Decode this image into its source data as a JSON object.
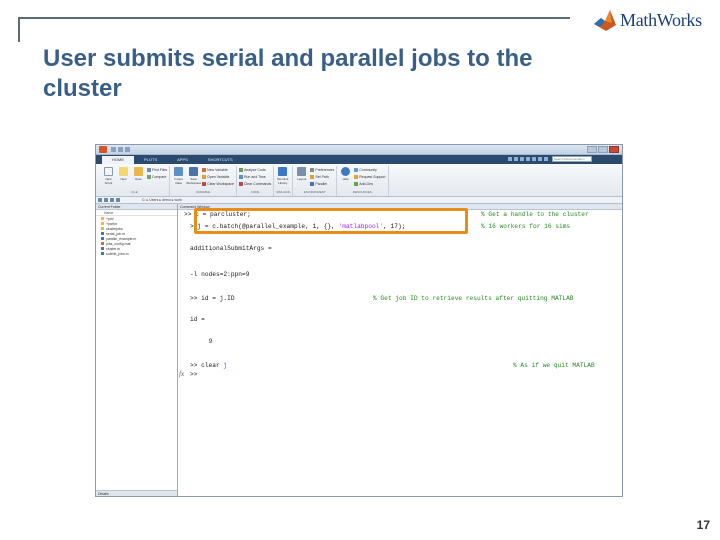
{
  "slide": {
    "title": "User submits serial and parallel jobs to the cluster",
    "logo_text": "MathWorks",
    "page_number": "17",
    "colors": {
      "title": "#3a5f86",
      "highlight": "#e58e1a",
      "frame": "#5a6b7a",
      "logo": "#1c3f7a"
    }
  },
  "matlab": {
    "tabs": [
      {
        "label": "HOME"
      },
      {
        "label": "PLOTS"
      },
      {
        "label": "APPS"
      },
      {
        "label": "SHORTCUTS"
      }
    ],
    "search_placeholder": "Search Documentation",
    "ribbon": {
      "groups": [
        {
          "label": "FILE",
          "big": [
            "New Script",
            "New",
            "Open"
          ],
          "small": [
            "Find Files",
            "Compare"
          ]
        },
        {
          "label": "VARIABLE",
          "big": [
            "Import Data",
            "Save Workspace"
          ],
          "small": [
            "New Variable",
            "Open Variable",
            "Clear Workspace"
          ]
        },
        {
          "label": "CODE",
          "small": [
            "Analyze Code",
            "Run and Time",
            "Clear Commands"
          ]
        },
        {
          "label": "SIMULINK",
          "big": [
            "Simulink Library"
          ]
        },
        {
          "label": "ENVIRONMENT",
          "big": [
            "Layout"
          ],
          "small": [
            "Preferences",
            "Set Path",
            "Parallel"
          ]
        },
        {
          "label": "RESOURCES",
          "big": [
            "Help"
          ],
          "small": [
            "Community",
            "Request Support",
            "Add-Ons"
          ]
        }
      ]
    },
    "address_path": "C: ▸ Users ▸ demo ▸ work",
    "current_folder": {
      "title": "Current Folder",
      "column_header": "Name",
      "items": [
        {
          "name": "+priv",
          "type": "folder"
        },
        {
          "name": "+parfor",
          "type": "folder"
        },
        {
          "name": "clusterjobs",
          "type": "folder"
        },
        {
          "name": "serial_job.m",
          "type": "m"
        },
        {
          "name": "parallel_example.m",
          "type": "m"
        },
        {
          "name": "jobs_config.mat",
          "type": "mat"
        },
        {
          "name": "cluster.m",
          "type": "m"
        },
        {
          "name": "submit_jobs.m",
          "type": "m"
        }
      ],
      "details_label": "Details"
    },
    "command_window": {
      "title": "Command Window",
      "lines": [
        {
          "code": ">> c = parcluster;",
          "comment": "% Get a handle to the cluster"
        },
        {
          "code_before": "> j = c.batch(@parallel_example, 1, {}, ",
          "code_string": "'matlabpool'",
          "code_after": ", 17);",
          "comment": "% 16 workers for 16 sims"
        },
        {
          "code": "additionalSubmitArgs ="
        },
        {
          "code": "-l nodes=2:ppn=9"
        },
        {
          "code": ">> id = j.ID",
          "comment": "% Get job ID to retrieve results after quitting MATLAB"
        },
        {
          "code": "id ="
        },
        {
          "code": "     9"
        },
        {
          "code_before": ">> clear ",
          "code_string": "j",
          "comment": "% As if we quit MATLAB"
        },
        {
          "code": ">>"
        }
      ],
      "fx_label": "fx",
      "colors": {
        "comment": "#228b22",
        "string": "#a020f0"
      }
    }
  }
}
